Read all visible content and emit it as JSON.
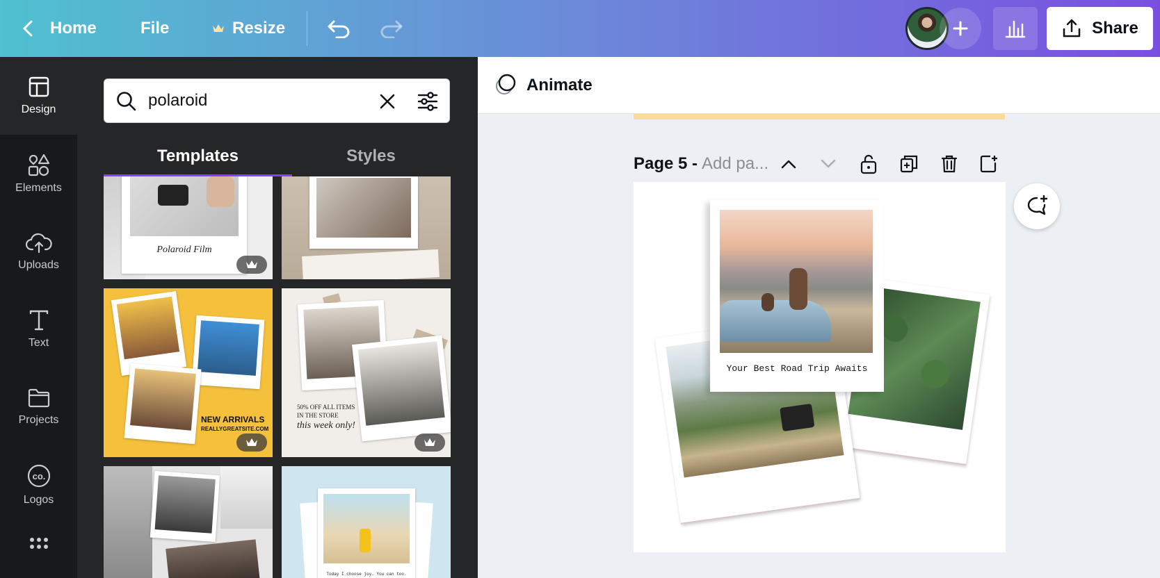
{
  "topbar": {
    "back_label": "Home",
    "file_label": "File",
    "resize_label": "Resize",
    "share_label": "Share"
  },
  "rail": {
    "items": [
      {
        "label": "Design",
        "icon": "layout-icon"
      },
      {
        "label": "Elements",
        "icon": "shapes-icon"
      },
      {
        "label": "Uploads",
        "icon": "cloud-upload-icon"
      },
      {
        "label": "Text",
        "icon": "text-icon"
      },
      {
        "label": "Projects",
        "icon": "folder-icon"
      },
      {
        "label": "Logos",
        "icon": "co-logo-icon"
      }
    ]
  },
  "panel": {
    "search_value": "polaroid",
    "tabs": [
      {
        "label": "Templates"
      },
      {
        "label": "Styles"
      }
    ],
    "templates": [
      {
        "text": "Polaroid Film",
        "premium": true
      },
      {
        "text": "",
        "premium": false
      },
      {
        "text": "NEW ARRIVALS",
        "subtext": "REALLYGREATSITE.COM",
        "premium": true
      },
      {
        "text": "50% OFF ALL ITEMS",
        "subtext": "IN THE STORE",
        "tagline": "this week only!",
        "premium": true
      },
      {
        "text": "",
        "premium": false
      },
      {
        "text": "Today I choose joy. You can too.",
        "premium": false
      }
    ]
  },
  "editor": {
    "animate_label": "Animate",
    "page_number": "Page 5 -",
    "page_title_placeholder": "Add pa...",
    "canvas_caption": "Your Best Road Trip Awaits"
  },
  "colors": {
    "accent": "#8b3dff",
    "panel_bg": "#252627",
    "rail_bg": "#18191b"
  }
}
